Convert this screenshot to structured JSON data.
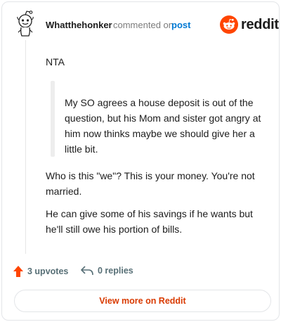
{
  "comment": {
    "username": "Whatthehonker",
    "action_text": "commented on",
    "post_link": "post",
    "paragraphs": [
      "NTA",
      "Who is this \"we\"? This is your money. You're not married.",
      "He can give some of his savings if he wants but he'll still owe his portion of bills."
    ],
    "quote": "My SO agrees a house deposit is out of the question, but his Mom and sister got angry at him now thinks maybe we should give her a little bit."
  },
  "brand": {
    "wordmark": "reddit",
    "logo_color": "#ff4500"
  },
  "footer": {
    "upvotes": "3 upvotes",
    "replies": "0 replies",
    "view_button": "View more on Reddit"
  },
  "icons": {
    "avatar": "snoo-avatar-icon",
    "upvote": "upvote-arrow-icon",
    "reply": "reply-arrow-icon",
    "logo": "reddit-logo-icon"
  }
}
